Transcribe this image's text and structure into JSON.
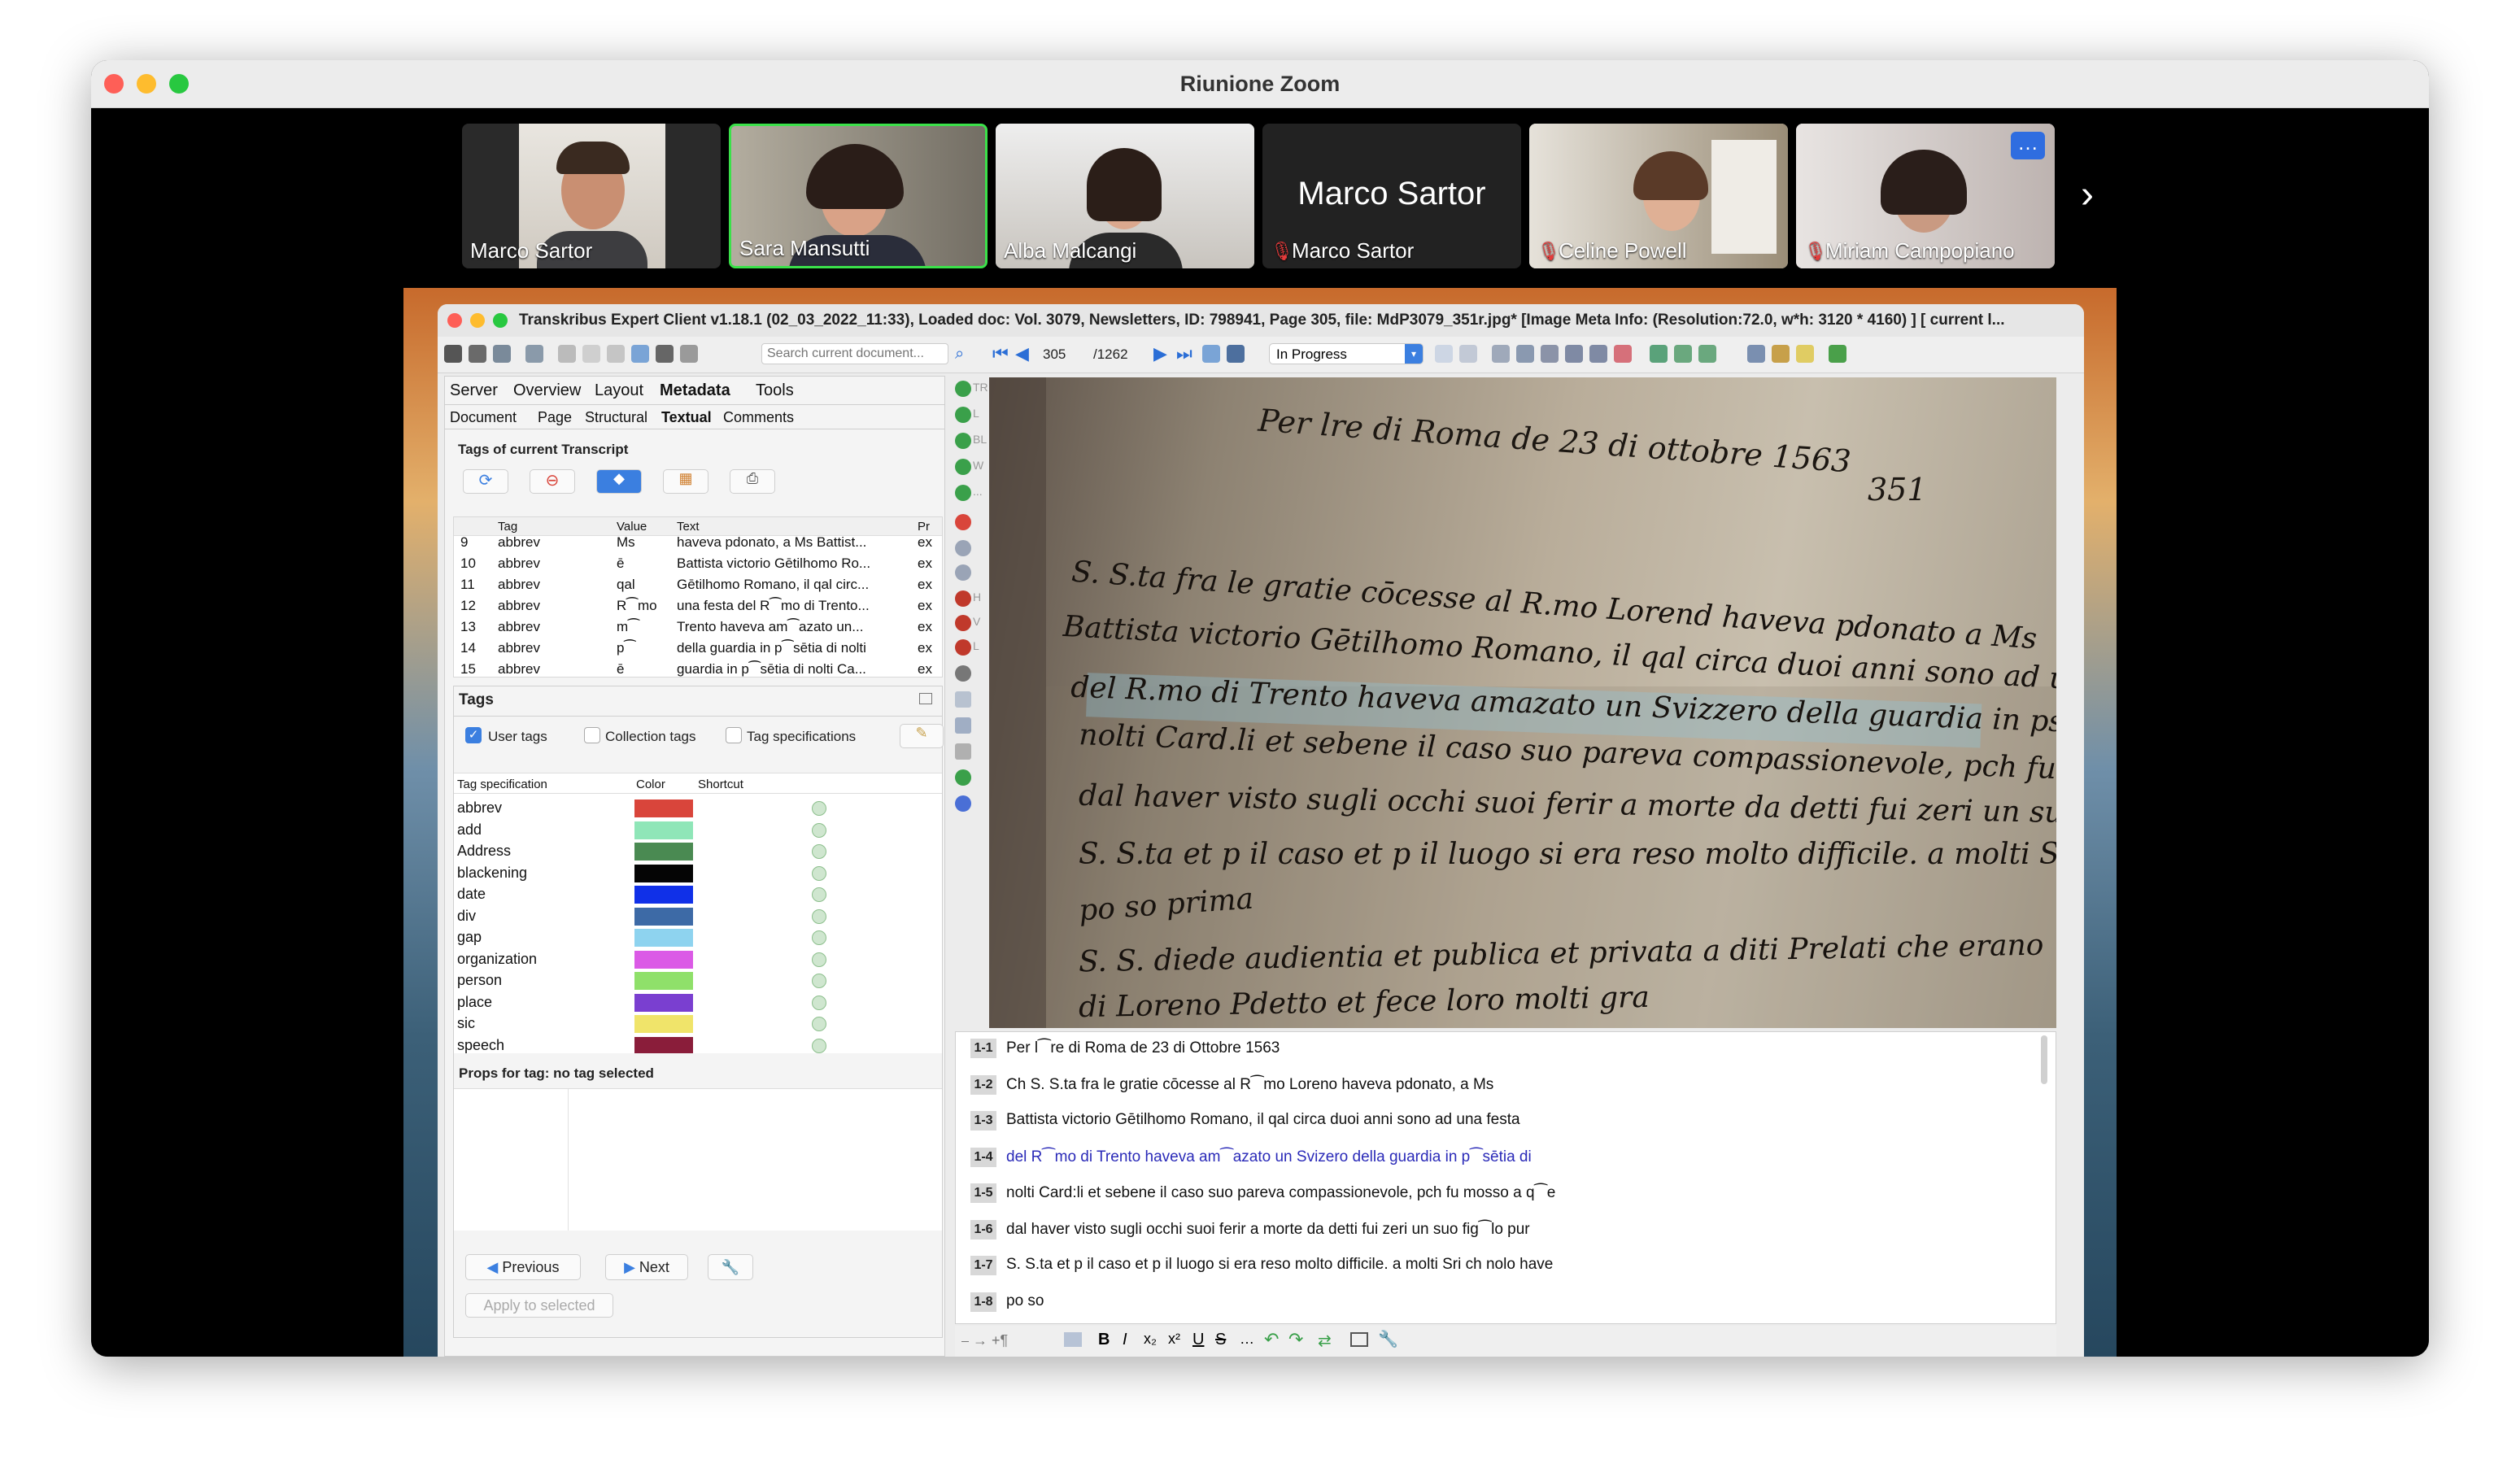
{
  "zoom": {
    "title": "Riunione Zoom",
    "participants": [
      {
        "name": "Marco Sartor",
        "muted": false,
        "video": true
      },
      {
        "name": "Sara Mansutti",
        "muted": false,
        "video": true,
        "active": true
      },
      {
        "name": "Alba Malcangi",
        "muted": false,
        "video": true
      },
      {
        "name": "Marco Sartor",
        "muted": true,
        "video": false,
        "big_name": "Marco Sartor"
      },
      {
        "name": "Celine Powell",
        "muted": true,
        "video": true
      },
      {
        "name": "Miriam Campopiano",
        "muted": true,
        "video": true
      }
    ],
    "more_icon": "ellipsis-icon",
    "next_icon": "chevron-right-icon"
  },
  "transkribus": {
    "title": "Transkribus Expert Client v1.18.1 (02_03_2022_11:33), Loaded doc: Vol. 3079, Newsletters, ID: 798941, Page 305, file: MdP3079_351r.jpg* [Image Meta Info: (Resolution:72.0, w*h: 3120 * 4160) ] [ current l...",
    "toolbar": {
      "search_placeholder": "Search current document...",
      "page_current": "305",
      "page_total": "/1262",
      "status": "In Progress"
    },
    "main_tabs": [
      "Server",
      "Overview",
      "Layout",
      "Metadata",
      "Tools"
    ],
    "active_main_tab": "Metadata",
    "sub_tabs": [
      "Document",
      "Page",
      "Structural",
      "Textual",
      "Comments"
    ],
    "active_sub_tab": "Textual",
    "tags_current": {
      "heading": "Tags of current Transcript",
      "columns": [
        "Tag",
        "Value",
        "Text",
        "Pr"
      ],
      "rows": [
        {
          "n": "9",
          "tag": "abbrev",
          "value": "Ms",
          "text": "haveva pdonato, a Ms Battist...",
          "pr": "ex"
        },
        {
          "n": "10",
          "tag": "abbrev",
          "value": "ē",
          "text": "Battista victorio Gētilhomo Ro...",
          "pr": "ex"
        },
        {
          "n": "11",
          "tag": "abbrev",
          "value": "qal",
          "text": "Gētilhomo Romano, il qal circ...",
          "pr": "ex"
        },
        {
          "n": "12",
          "tag": "abbrev",
          "value": "R⁀mo",
          "text": "una festa del R⁀mo di Trento...",
          "pr": "ex"
        },
        {
          "n": "13",
          "tag": "abbrev",
          "value": "m⁀",
          "text": "Trento haveva am⁀azato un...",
          "pr": "ex"
        },
        {
          "n": "14",
          "tag": "abbrev",
          "value": "p⁀",
          "text": "della guardia in p⁀sētia di nolti",
          "pr": "ex"
        },
        {
          "n": "15",
          "tag": "abbrev",
          "value": "ē",
          "text": "guardia in p⁀sētia di nolti Ca...",
          "pr": "ex"
        }
      ]
    },
    "tags_panel": {
      "heading": "Tags",
      "checkboxes": [
        {
          "label": "User tags",
          "checked": true
        },
        {
          "label": "Collection tags",
          "checked": false
        },
        {
          "label": "Tag specifications",
          "checked": false
        }
      ],
      "columns": [
        "Tag specification",
        "Color",
        "Shortcut"
      ],
      "specs": [
        {
          "name": "abbrev",
          "color": "#d9453b"
        },
        {
          "name": "add",
          "color": "#8fe6b8"
        },
        {
          "name": "Address",
          "color": "#4a8a52"
        },
        {
          "name": "blackening",
          "color": "#050505"
        },
        {
          "name": "date",
          "color": "#1030e8"
        },
        {
          "name": "div",
          "color": "#3d6aa6"
        },
        {
          "name": "gap",
          "color": "#8ed3ef"
        },
        {
          "name": "organization",
          "color": "#db5ae6"
        },
        {
          "name": "person",
          "color": "#8fe06a"
        },
        {
          "name": "place",
          "color": "#7a3fd0"
        },
        {
          "name": "sic",
          "color": "#f0e46a"
        },
        {
          "name": "speech",
          "color": "#8a1d3a"
        }
      ],
      "props_heading": "Props for tag: no tag selected",
      "previous": "Previous",
      "next": "Next",
      "apply": "Apply to selected"
    },
    "side_labels": [
      "TR",
      "L",
      "BL",
      "W",
      "...",
      "H",
      "V",
      "L"
    ],
    "manuscript_lines": [
      "Per lre di Roma de 23 di ottobre 1563",
      "S. S.ta fra le gratie cōcesse al R.mo Lorend haveva pdonato a Ms",
      "Battista victorio Gētilhomo Romano, il qal circa duoi anni sono ad una festa",
      "del R.mo di Trento haveva amazato un Svizzero della guardia in psētia di",
      "nolti Card.li et sebene il caso suo pareva compassionevole, pch fu mosso a q.e",
      "dal haver visto sugli occhi suoi ferir a morte da detti fui zeri un suo figlo pur",
      "S. S.ta et p il caso et p il luogo si era reso molto difficile. a molti Sri ch nolo have",
      "po so prima",
      "S. S. diede audientia et publica et privata a diti Prelati che erano",
      "di Loreno Pdetto et fece loro molti gra"
    ],
    "page_number_handwritten": "351",
    "transcript": [
      {
        "num": "1-1",
        "text": "Per l⁀re di Roma de 23 di Ottobre 1563",
        "color": "#111111"
      },
      {
        "num": "1-2",
        "text": "Ch S. S.ta fra le gratie cōcesse al R⁀mo Loreno haveva pdonato, a Ms",
        "color": "#111111"
      },
      {
        "num": "1-3",
        "text": "Battista victorio Gētilhomo Romano, il qal circa duoi anni sono ad una festa",
        "color": "#111111"
      },
      {
        "num": "1-4",
        "text": "del R⁀mo di Trento haveva am⁀azato un Svizero della guardia in p⁀sētia di",
        "color": "#2a2ab8"
      },
      {
        "num": "1-5",
        "text": "nolti Card:li et sebene il caso suo pareva compassionevole, pch fu mosso a q⁀e",
        "color": "#111111"
      },
      {
        "num": "1-6",
        "text": "dal haver visto sugli occhi suoi ferir a morte da detti fui zeri un suo fig⁀lo pur",
        "color": "#111111"
      },
      {
        "num": "1-7",
        "text": "S. S.ta et p il caso et p il luogo si era reso molto difficile. a molti Sri ch nolo have",
        "color": "#111111"
      },
      {
        "num": "1-8",
        "text": "po so",
        "color": "#111111"
      }
    ]
  }
}
